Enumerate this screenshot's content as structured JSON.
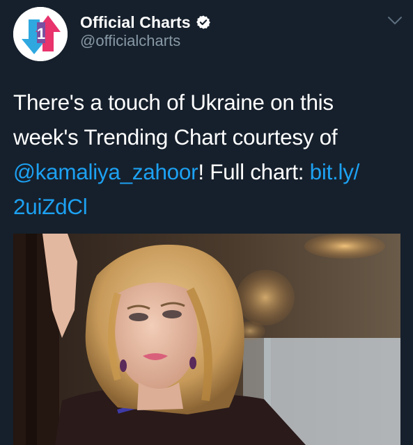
{
  "account": {
    "display_name": "Official Charts",
    "handle": "@officialcharts",
    "avatar_icon": "official-charts-logo",
    "verified_icon": "verified-badge-icon",
    "menu_icon": "chevron-down-icon"
  },
  "tweet": {
    "text_before": "There's a touch of Ukraine on this week's Trending Chart courtesy of ",
    "mention": "@kamaliya_zahoor",
    "text_middle": "! Full chart: ",
    "link": "bit.ly/ 2uiZdCl"
  },
  "media": {
    "description_icon": "photo-of-woman"
  },
  "colors": {
    "background": "#16202c",
    "link": "#1da1f2",
    "secondary_text": "#8899a6",
    "logo_pink": "#e8336d",
    "logo_blue": "#2fa8e0"
  }
}
